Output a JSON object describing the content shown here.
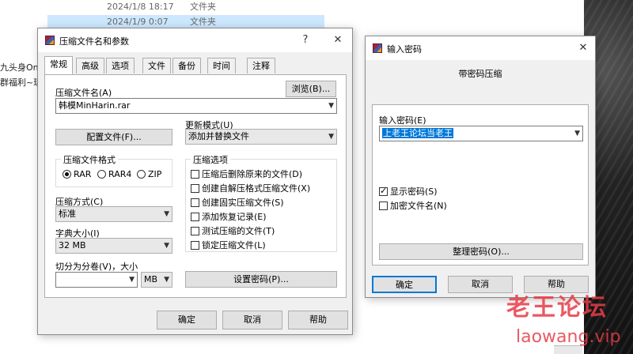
{
  "explorer": {
    "rows": [
      {
        "date": "2024/1/8 18:17",
        "type": "文件夹"
      },
      {
        "date": "2024/1/9 0:07",
        "type": "文件夹"
      }
    ],
    "left_items": [
      "九头身Onl",
      "群福利~瑞"
    ]
  },
  "archive_dialog": {
    "title": "压缩文件名和参数",
    "help_glyph": "?",
    "close_glyph": "✕",
    "tabs": [
      "常规",
      "高级",
      "选项",
      "文件",
      "备份",
      "时间",
      "注释"
    ],
    "archive_name_label": "压缩文件名(A)",
    "archive_name_value": "韩模MinHarin.rar",
    "browse_button": "浏览(B)...",
    "profiles_button": "配置文件(F)...",
    "update_mode_label": "更新模式(U)",
    "update_mode_value": "添加并替换文件",
    "format_group": "压缩文件格式",
    "formats": [
      {
        "label": "RAR",
        "selected": true
      },
      {
        "label": "RAR4",
        "selected": false
      },
      {
        "label": "ZIP",
        "selected": false
      }
    ],
    "method_label": "压缩方式(C)",
    "method_value": "标准",
    "dict_label": "字典大小(I)",
    "dict_value": "32 MB",
    "split_label": "切分为分卷(V)，大小",
    "split_value": "",
    "split_unit": "MB",
    "options_group": "压缩选项",
    "options": [
      {
        "label": "压缩后删除原来的文件(D)",
        "checked": false
      },
      {
        "label": "创建自解压格式压缩文件(X)",
        "checked": false
      },
      {
        "label": "创建固实压缩文件(S)",
        "checked": false
      },
      {
        "label": "添加恢复记录(E)",
        "checked": false
      },
      {
        "label": "测试压缩的文件(T)",
        "checked": false
      },
      {
        "label": "锁定压缩文件(L)",
        "checked": false
      }
    ],
    "set_password_button": "设置密码(P)...",
    "ok_button": "确定",
    "cancel_button": "取消",
    "help_button": "帮助"
  },
  "password_dialog": {
    "title": "输入密码",
    "close_glyph": "✕",
    "heading": "带密码压缩",
    "password_label": "输入密码(E)",
    "password_value": "上老王论坛当老王",
    "show_password": {
      "label": "显示密码(S)",
      "checked": true
    },
    "encrypt_names": {
      "label": "加密文件名(N)",
      "checked": false
    },
    "organize_button": "整理密码(O)...",
    "ok_button": "确定",
    "cancel_button": "取消",
    "help_button": "帮助"
  },
  "watermark": {
    "text": "老王论坛",
    "url": "laowang.vip"
  },
  "colors": {
    "selection": "#0078d7",
    "window_bg": "#f0f0f0",
    "watermark": "#e63c46"
  }
}
